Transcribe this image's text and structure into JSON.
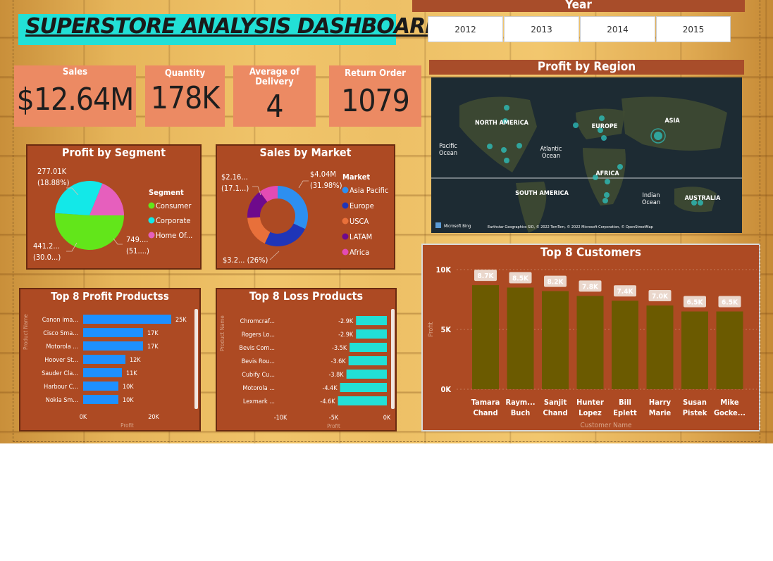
{
  "title": "SUPERSTORE ANALYSIS DASHBOARD",
  "year_slicer": {
    "title": "Year",
    "options": [
      "2012",
      "2013",
      "2014",
      "2015"
    ]
  },
  "kpis": [
    {
      "label": "Sales",
      "value": "$12.64M"
    },
    {
      "label": "Quantity",
      "value": "178K"
    },
    {
      "label": "Average of Delivery",
      "value": "4"
    },
    {
      "label": "Return Order",
      "value": "1079"
    }
  ],
  "colors": {
    "panel": "#ad4a23",
    "accent_title": "#22e0d6",
    "kpi": "#ec8a63",
    "blue_bar": "#1e90ff",
    "cyan_bar": "#22e0d6",
    "olive_bar": "#6b5a00"
  },
  "map": {
    "title": "Profit by Region",
    "labels": [
      "NORTH AMERICA",
      "EUROPE",
      "ASIA",
      "AFRICA",
      "SOUTH AMERICA",
      "AUSTRALIA",
      "Pacific Ocean",
      "Atlantic Ocean",
      "Indian Ocean"
    ],
    "attribution": "Earthstar Geographics SIO, © 2022 TomTom, © 2022 Microsoft Corporation, © OpenStreetMap",
    "logo": "Microsoft Bing"
  },
  "chart_data": [
    {
      "id": "profit_by_segment",
      "type": "pie",
      "title": "Profit by Segment",
      "legend_title": "Segment",
      "legend_position": "right",
      "categories": [
        "Consumer",
        "Corporate",
        "Home Of..."
      ],
      "colors": [
        "#62e61a",
        "#13e8e8",
        "#e65fbd"
      ],
      "values": [
        749,
        441.2,
        277.01
      ],
      "data_labels": [
        "749.... (51....)",
        "441.2... (30.0...)",
        "277.01K (18.88%)"
      ]
    },
    {
      "id": "sales_by_market",
      "type": "pie",
      "title": "Sales by Market",
      "legend_title": "Market",
      "legend_position": "right",
      "categories": [
        "Asia Pacific",
        "Europe",
        "USCA",
        "LATAM",
        "Africa"
      ],
      "colors": [
        "#2d8ff0",
        "#1f35b8",
        "#e8703a",
        "#6e0a8c",
        "#e34bb4"
      ],
      "values": [
        31.98,
        25.0,
        17.1,
        15.92,
        10.0
      ],
      "data_labels": [
        "$4.04M (31.98%)",
        "$3.2... (26%)",
        "$2.16... (17.1...)"
      ]
    },
    {
      "id": "top8_profit_products",
      "type": "bar",
      "orientation": "horizontal",
      "title": "Top 8 Profit Productss",
      "xlabel": "Profit",
      "ylabel": "Product Name",
      "xlim": [
        0,
        25000
      ],
      "x_ticks": [
        "0K",
        "20K"
      ],
      "categories": [
        "Canon ima...",
        "Cisco Sma...",
        "Motorola ...",
        "Hoover St...",
        "Sauder Cla...",
        "Harbour C...",
        "Nokia Sm..."
      ],
      "values": [
        25000,
        17000,
        17000,
        12000,
        11000,
        10000,
        10000
      ],
      "data_labels": [
        "25K",
        "17K",
        "17K",
        "12K",
        "11K",
        "10K",
        "10K"
      ]
    },
    {
      "id": "top8_loss_products",
      "type": "bar",
      "orientation": "horizontal",
      "title": "Top 8 Loss Products",
      "xlabel": "Profit",
      "ylabel": "Product Name",
      "xlim": [
        -10000,
        0
      ],
      "x_ticks": [
        "-10K",
        "-5K",
        "0K"
      ],
      "categories": [
        "Chromcraf...",
        "Rogers Lo...",
        "Bevis Com...",
        "Bevis Rou...",
        "Cubify Cu...",
        "Motorola ...",
        "Lexmark ..."
      ],
      "values": [
        -2900,
        -2900,
        -3500,
        -3600,
        -3800,
        -4400,
        -4600
      ],
      "data_labels": [
        "-2.9K",
        "-2.9K",
        "-3.5K",
        "-3.6K",
        "-3.8K",
        "-4.4K",
        "-4.6K"
      ]
    },
    {
      "id": "top8_customers",
      "type": "bar",
      "orientation": "vertical",
      "title": "Top 8 Customers",
      "xlabel": "Customer Name",
      "ylabel": "Profit",
      "ylim": [
        0,
        10000
      ],
      "y_ticks": [
        "0K",
        "5K",
        "10K"
      ],
      "categories": [
        [
          "Tamara",
          "Chand"
        ],
        [
          "Raym...",
          "Buch"
        ],
        [
          "Sanjit",
          "Chand"
        ],
        [
          "Hunter",
          "Lopez"
        ],
        [
          "Bill",
          "Eplett"
        ],
        [
          "Harry",
          "Marie"
        ],
        [
          "Susan",
          "Pistek"
        ],
        [
          "Mike",
          "Gocke..."
        ]
      ],
      "values": [
        8700,
        8500,
        8200,
        7800,
        7400,
        7000,
        6500,
        6500
      ],
      "data_labels": [
        "8.7K",
        "8.5K",
        "8.2K",
        "7.8K",
        "7.4K",
        "7.0K",
        "6.5K",
        "6.5K"
      ]
    }
  ]
}
